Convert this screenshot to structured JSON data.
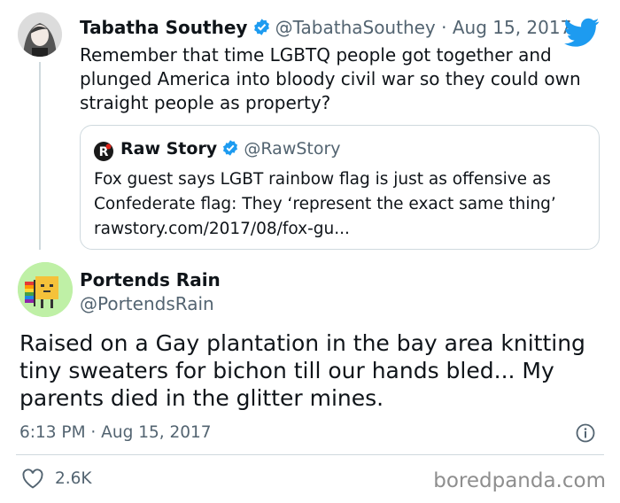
{
  "colors": {
    "twitter_blue": "#1d9bf0",
    "text": "#0f1419",
    "muted": "#536471",
    "border": "#cfd9de"
  },
  "original_tweet": {
    "display_name": "Tabatha Southey",
    "handle_date": "@TabathaSouthey · Aug 15, 2017",
    "text_lines": [
      "Remember that time LGBTQ people got together and",
      "plunged America into bloody civil war so they could own",
      "straight people as property?"
    ],
    "icons": {
      "verified": "verified-badge-icon",
      "logo": "twitter-bird-icon"
    }
  },
  "quoted_tweet": {
    "display_name": "Raw Story",
    "handle": "@RawStory",
    "text_lines": [
      "Fox guest says LGBT rainbow flag is just as offensive as",
      "Confederate flag: They ‘represent the exact same thing’",
      "rawstory.com/2017/08/fox-gu..."
    ]
  },
  "reply_tweet": {
    "display_name": "Portends Rain",
    "handle": "@PortendsRain",
    "text_lines": [
      "Raised on a Gay plantation in the bay area knitting",
      "tiny sweaters for bichon till our hands bled... My",
      "parents died in the glitter mines."
    ],
    "timestamp": "6:13 PM · Aug 15, 2017",
    "likes": "2.6K"
  },
  "watermark": "boredpanda.com"
}
